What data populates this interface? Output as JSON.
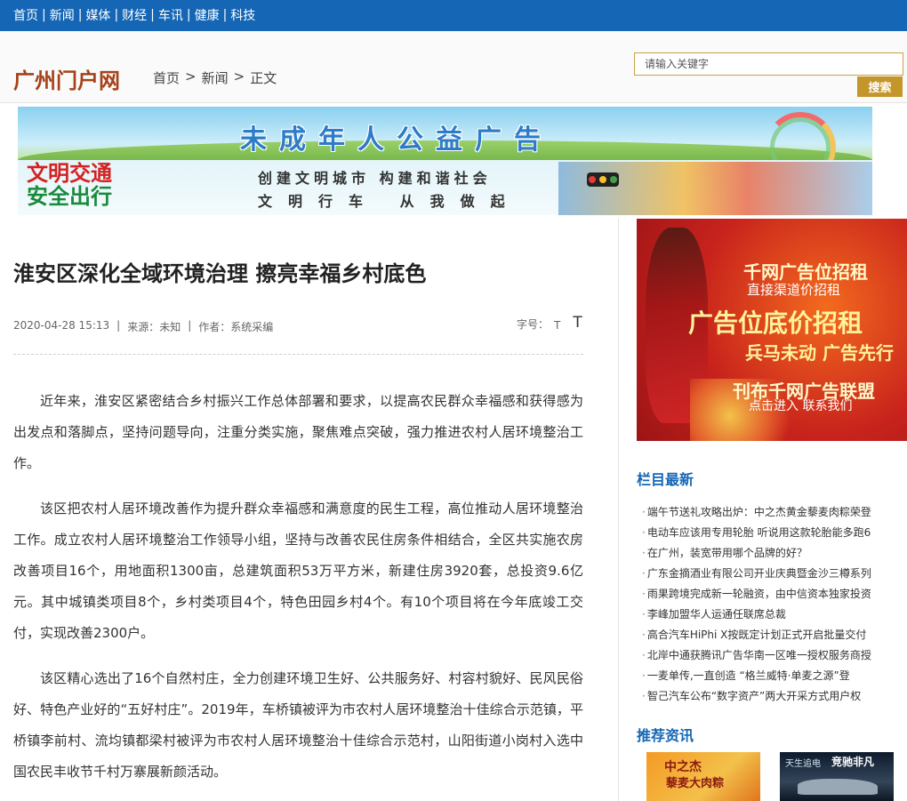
{
  "topnav": {
    "items": [
      "首页",
      "新闻",
      "媒体",
      "财经",
      "车讯",
      "健康",
      "科技"
    ],
    "separator": "|"
  },
  "header": {
    "logo": "广州门户网",
    "breadcrumb": [
      "首页",
      ">",
      "新闻",
      ">",
      "正文"
    ],
    "search_placeholder": "请输入关键字",
    "search_button": "搜索"
  },
  "banner": {
    "title": "未成年人公益广告",
    "slogan_left_1": "文明交通",
    "slogan_left_2": "安全出行",
    "slogan_right_1": "创建文明城市  构建和谐社会",
    "slogan_right_2": "文明行车  从我做起"
  },
  "article": {
    "title": "淮安区深化全域环境治理 擦亮幸福乡村底色",
    "date": "2020-04-28 15:13",
    "source": "来源：未知",
    "author": "作者：系统采编",
    "font_size_label": "字号：",
    "font_small": "T",
    "font_large": "T",
    "paragraphs": [
      "近年来，淮安区紧密结合乡村振兴工作总体部署和要求，以提高农民群众幸福感和获得感为出发点和落脚点，坚持问题导向，注重分类实施，聚焦难点突破，强力推进农村人居环境整治工作。",
      "该区把农村人居环境改善作为提升群众幸福感和满意度的民生工程，高位推动人居环境整治工作。成立农村人居环境整治工作领导小组，坚持与改善农民住房条件相结合，全区共实施农房改善项目16个，用地面积1300亩，总建筑面积53万平方米，新建住房3920套，总投资9.6亿元。其中城镇类项目8个，乡村类项目4个，特色田园乡村4个。有10个项目将在今年底竣工交付，实现改善2300户。",
      "该区精心选出了16个自然村庄，全力创建环境卫生好、公共服务好、村容村貌好、民风民俗好、特色产业好的“五好村庄”。2019年，车桥镇被评为市农村人居环境整治十佳综合示范镇，平桥镇李前村、流均镇都梁村被评为市农村人居环境整治十佳综合示范村，山阳街道小岗村入选中国农民丰收节千村万寨展新颜活动。"
    ]
  },
  "sidebar": {
    "ad": {
      "line1": "千网广告位招租",
      "line2": "直接渠道价招租",
      "line3": "广告位底价招租",
      "line4": "兵马未动 广告先行",
      "line5": "刊布千网广告联盟",
      "line6": "点击进入 联系我们"
    },
    "latest_title": "栏目最新",
    "latest": [
      "端午节送礼攻略出炉：中之杰黄金藜麦肉粽荣登",
      "电动车应该用专用轮胎 听说用这款轮胎能多跑6",
      "在广州，装宽带用哪个品牌的好？",
      "广东金摘酒业有限公司开业庆典暨金沙三樽系列",
      "雨果跨境完成新一轮融资，由中信资本独家投资",
      "李峰加盟华人运通任联席总裁",
      "高合汽车HiPhi X按既定计划正式开启批量交付",
      "北岸中通获腾讯广告华南一区唯一授权服务商授",
      "一麦单传,一直创造 “格兰威特·单麦之源”登",
      "智己汽车公布“数字资产”两大开采方式用户权"
    ],
    "recommend_title": "推荐资讯",
    "recommend": [
      {
        "line1": "中之杰",
        "line2": "藜麦大肉粽"
      },
      {
        "line1": "天生追电",
        "line2": "竞驰非凡"
      }
    ]
  }
}
